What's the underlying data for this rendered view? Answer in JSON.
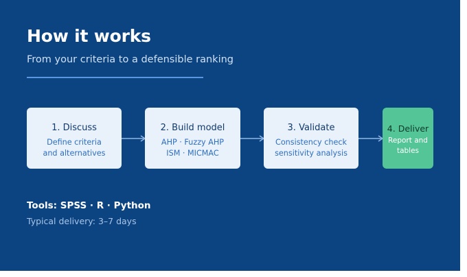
{
  "header": {
    "title": "How it works",
    "subtitle": "From your criteria to a defensible ranking"
  },
  "steps": [
    {
      "title": "1. Discuss",
      "line1": "Define criteria",
      "line2": "and alternatives"
    },
    {
      "title": "2. Build model",
      "line1": "AHP · Fuzzy AHP",
      "line2": "ISM · MICMAC"
    },
    {
      "title": "3. Validate",
      "line1": "Consistency check",
      "line2": "sensitivity analysis"
    },
    {
      "title": "4. Deliver",
      "line1": "Report and",
      "line2": "tables"
    }
  ],
  "footer": {
    "tools": "Tools: SPSS · R · Python",
    "delivery": "Typical delivery: 3–7 days"
  },
  "colors": {
    "background": "#0c4481",
    "card": "#e9f1fb",
    "highlight": "#54c596",
    "accent_line": "#5b97e0"
  }
}
